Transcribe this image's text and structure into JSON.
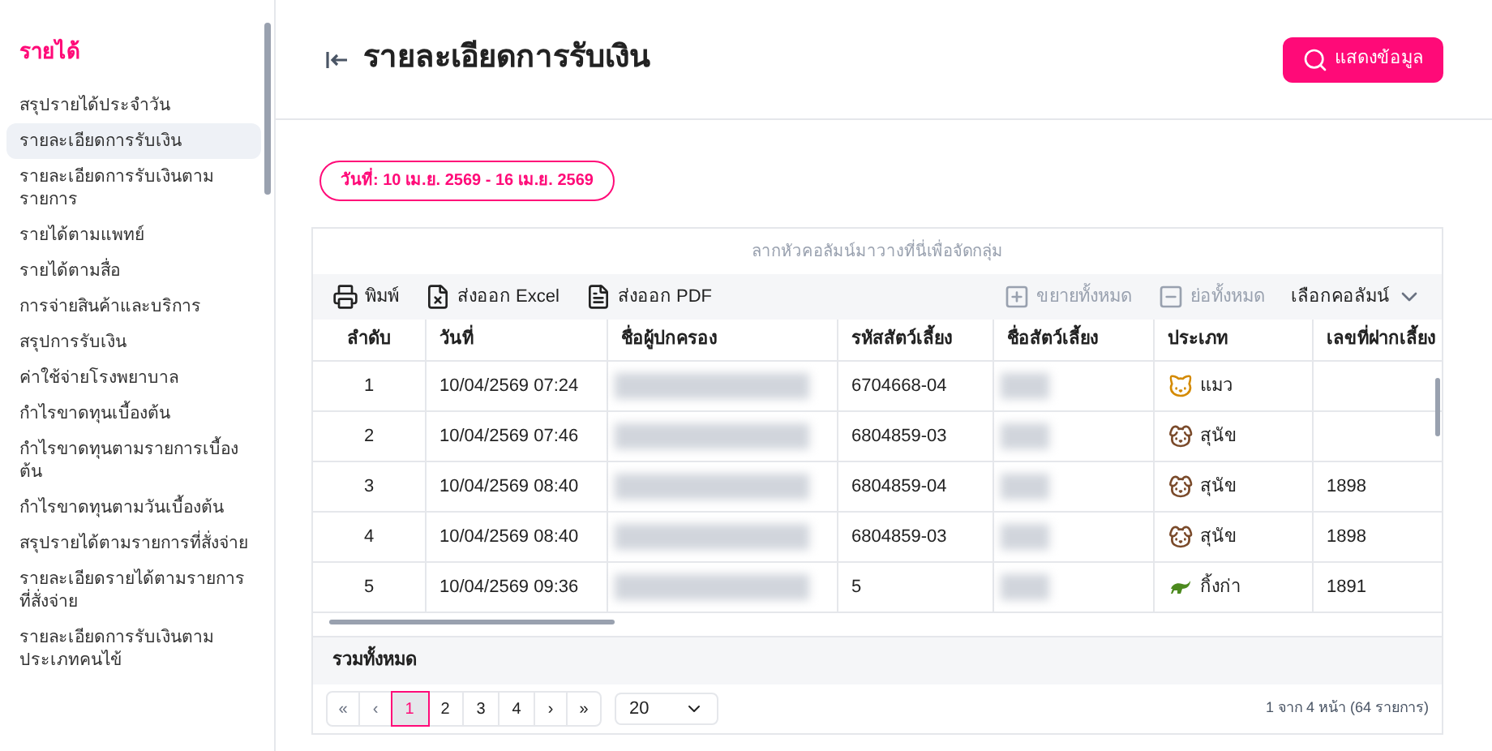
{
  "sidebar": {
    "section": "รายได้",
    "items": [
      {
        "label": "สรุปรายได้ประจำวัน",
        "selected": false
      },
      {
        "label": "รายละเอียดการรับเงิน",
        "selected": true
      },
      {
        "label": "รายละเอียดการรับเงินตามรายการ",
        "selected": false
      },
      {
        "label": "รายได้ตามแพทย์",
        "selected": false
      },
      {
        "label": "รายได้ตามสื่อ",
        "selected": false
      },
      {
        "label": "การจ่ายสินค้าและบริการ",
        "selected": false
      },
      {
        "label": "สรุปการรับเงิน",
        "selected": false
      },
      {
        "label": "ค่าใช้จ่ายโรงพยาบาล",
        "selected": false
      },
      {
        "label": "กำไรขาดทุนเบื้องต้น",
        "selected": false
      },
      {
        "label": "กำไรขาดทุนตามรายการเบื้องต้น",
        "selected": false
      },
      {
        "label": "กำไรขาดทุนตามวันเบื้องต้น",
        "selected": false
      },
      {
        "label": "สรุปรายได้ตามรายการที่สั่งจ่าย",
        "selected": false
      },
      {
        "label": "รายละเอียดรายได้ตามรายการที่สั่งจ่าย",
        "selected": false
      },
      {
        "label": "รายละเอียดการรับเงินตามประเภทคนไข้",
        "selected": false
      }
    ]
  },
  "header": {
    "title": "รายละเอียดการรับเงิน",
    "show_button": "แสดงข้อมูล"
  },
  "date_range": "วันที่: 10 เม.ย. 2569 - 16 เม.ย. 2569",
  "grid": {
    "group_hint": "ลากหัวคอลัมน์มาวางที่นี่เพื่อจัดกลุ่ม",
    "toolbar": [
      {
        "label": "พิมพ์",
        "kind": "print",
        "disabled": false
      },
      {
        "label": "ส่งออก Excel",
        "kind": "excel",
        "disabled": false
      },
      {
        "label": "ส่งออก PDF",
        "kind": "pdf",
        "disabled": false
      },
      {
        "label": "ขยายทั้งหมด",
        "kind": "expand",
        "disabled": true
      },
      {
        "label": "ย่อทั้งหมด",
        "kind": "collapse",
        "disabled": true
      }
    ],
    "column_chooser": "เลือกคอลัมน์",
    "columns": [
      "ลำดับ",
      "วันที่",
      "ชื่อผู้ปกครอง",
      "รหัสสัตว์เลี้ยง",
      "ชื่อสัตว์เลี้ยง",
      "ประเภท",
      "เลขที่ฝากเลี้ยง"
    ],
    "rows": [
      {
        "no": "1",
        "date": "10/04/2569 07:24",
        "pet_code": "6704668-04",
        "species": "แมว",
        "kind": "cat"
      },
      {
        "no": "2",
        "date": "10/04/2569 07:46",
        "pet_code": "6804859-03",
        "species": "สุนัข",
        "kind": "dog"
      },
      {
        "no": "3",
        "date": "10/04/2569 08:40",
        "pet_code": "6804859-04",
        "species": "สุนัข",
        "kind": "dog",
        "boarding_no": "1898"
      },
      {
        "no": "4",
        "date": "10/04/2569 08:40",
        "pet_code": "6804859-03",
        "species": "สุนัข",
        "kind": "dog",
        "boarding_no": "1898"
      },
      {
        "no": "5",
        "date": "10/04/2569 09:36",
        "pet_code": "5",
        "species": "กิ้งก่า",
        "kind": "lizard",
        "boarding_no": "1891"
      }
    ],
    "total_label": "รวมทั้งหมด",
    "pager": {
      "first": "«",
      "prev": "‹",
      "pages": [
        {
          "label": "1",
          "selected": true
        },
        {
          "label": "2",
          "selected": false
        },
        {
          "label": "3",
          "selected": false
        },
        {
          "label": "4",
          "selected": false
        }
      ],
      "next": "›",
      "last": "»",
      "page_size": "20",
      "summary": "1 จาก 4 หน้า (64 รายการ)"
    }
  }
}
